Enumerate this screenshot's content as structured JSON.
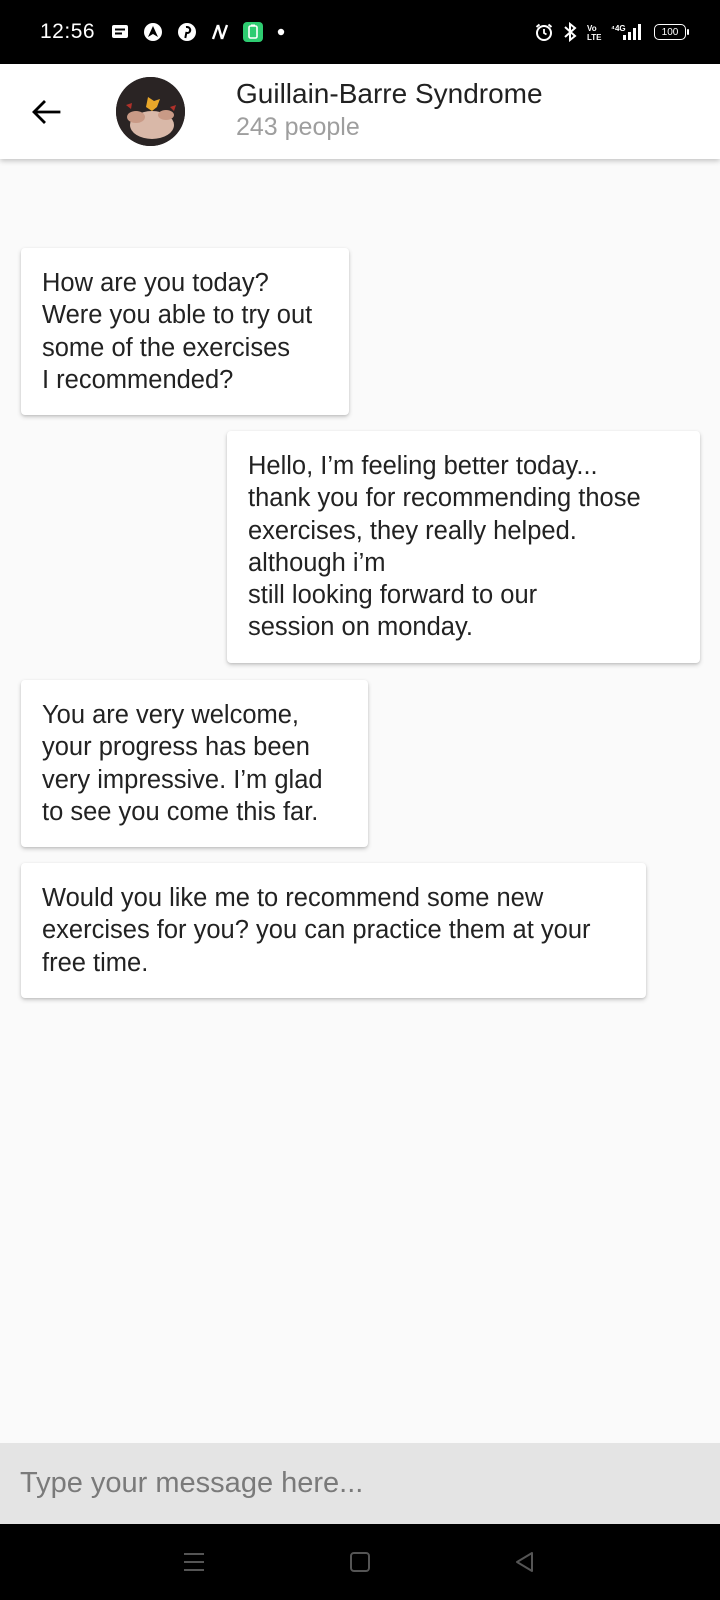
{
  "status_bar": {
    "time": "12:56",
    "battery": "100",
    "left_icons": [
      "message-icon",
      "nav-app-icon",
      "pinterest-icon",
      "n-app-icon",
      "battery-saver-icon",
      "dot-icon"
    ],
    "right_icons": [
      "alarm-icon",
      "bluetooth-icon",
      "volte-icon",
      "signal-4g-icon",
      "battery-icon"
    ]
  },
  "header": {
    "title": "Guillain-Barre Syndrome",
    "subtitle": "243 people"
  },
  "messages": [
    {
      "side": "left",
      "text": "How are you today?\nWere you able to try out\nsome of the exercises\nI recommended?"
    },
    {
      "side": "right",
      "text": "Hello, I’m feeling better today...\nthank you for recommending those\nexercises, they really helped.\nalthough i’m\nstill looking forward to our\nsession on monday."
    },
    {
      "side": "left",
      "text": "You are very welcome,\nyour progress has been\nvery impressive. I’m glad\nto see you come this far."
    },
    {
      "side": "left",
      "text": "Would you like me to recommend some new\nexercises for you? you can practice them at your\nfree time."
    }
  ],
  "input": {
    "placeholder": "Type your message here...",
    "value": ""
  },
  "colors": {
    "status_bar": "#000000",
    "app_bar": "#ffffff",
    "background": "#fafafa",
    "input_bar": "#e4e4e4",
    "subtitle": "#9e9e9e"
  }
}
